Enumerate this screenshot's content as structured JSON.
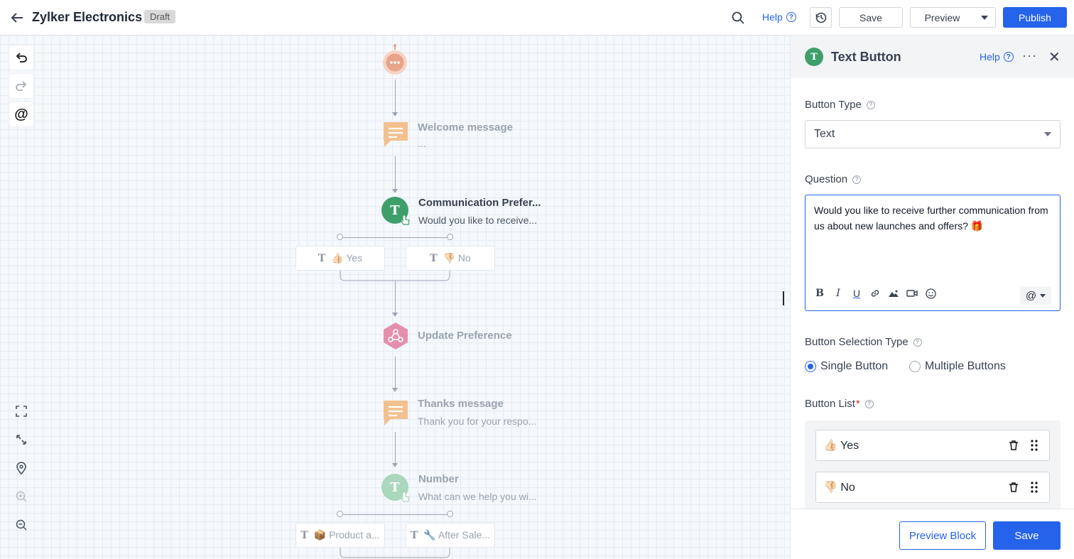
{
  "header": {
    "back_icon": "arrow-left-icon",
    "title": "Zylker Electronics",
    "status": "Draft",
    "help": "Help",
    "save": "Save",
    "preview": "Preview",
    "publish": "Publish"
  },
  "canvas": {
    "nodes": [
      {
        "title": "Welcome message",
        "sub": "..."
      },
      {
        "title": "Communication Prefer...",
        "sub": "Would you like to receive..."
      },
      {
        "title": "Update Preference",
        "sub": ""
      },
      {
        "title": "Thanks message",
        "sub": "Thank you for your respo..."
      },
      {
        "title": "Number",
        "sub": "What can we help you wi..."
      }
    ],
    "branches_1": [
      "👍🏻 Yes",
      "👎🏻 No"
    ],
    "branches_2": [
      "📦 Product a...",
      "🔧 After Sale..."
    ],
    "colors": {
      "accent": "#2563eb",
      "text_block": "#f2c18e",
      "button_block": "#3f9f6b",
      "webhook": "#e58fac",
      "start": "#e8a38a"
    }
  },
  "panel": {
    "title": "Text Button",
    "help": "Help",
    "button_type_label": "Button Type",
    "button_type_value": "Text",
    "question_label": "Question",
    "question_text": "Would you like to receive further communication from us about new launches and offers? 🎁",
    "selection_type_label": "Button Selection Type",
    "single": "Single Button",
    "multiple": "Multiple Buttons",
    "button_list_label": "Button List",
    "required_mark": "*",
    "buttons": [
      "👍🏻 Yes",
      "👎🏻 No"
    ],
    "preview_block": "Preview Block",
    "save": "Save"
  }
}
